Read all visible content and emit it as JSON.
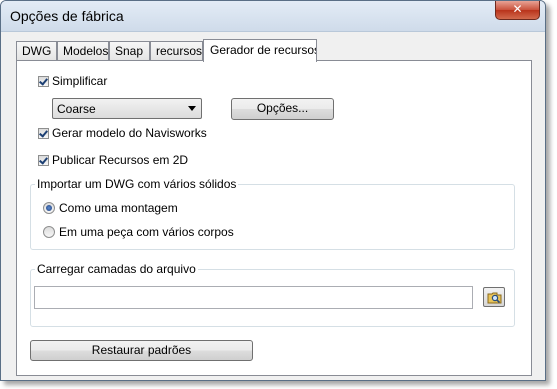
{
  "window": {
    "title": "Opções de fábrica",
    "close_glyph": "✕"
  },
  "tabs": [
    {
      "label": "DWG"
    },
    {
      "label": "Modelos"
    },
    {
      "label": "Snap"
    },
    {
      "label": "recursos"
    },
    {
      "label": "Gerador de recursos",
      "active": true
    }
  ],
  "panel": {
    "simplify_label": "Simplificar",
    "simplify_checked": true,
    "quality_select": {
      "value": "Coarse"
    },
    "options_button": "Opções...",
    "navisworks_label": "Gerar modelo do Navisworks",
    "navisworks_checked": true,
    "publish2d_label": "Publicar Recursos em 2D",
    "publish2d_checked": true,
    "import_group": {
      "label": "Importar um DWG com vários sólidos",
      "options": [
        {
          "label": "Como uma montagem",
          "selected": true
        },
        {
          "label": "Em uma peça com vários corpos",
          "selected": false
        }
      ]
    },
    "layers_group": {
      "label": "Carregar camadas do arquivo",
      "input_value": "",
      "browse_icon": "folder-search-icon"
    },
    "restore_button": "Restaurar padrões"
  }
}
